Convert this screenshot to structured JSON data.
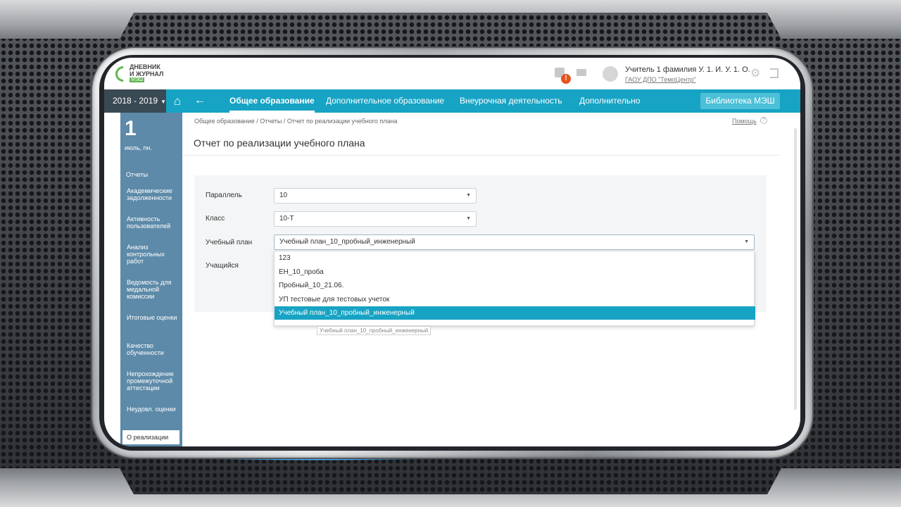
{
  "header": {
    "logo_line1": "ДНЕВНИК",
    "logo_line2": "И ЖУРНАЛ",
    "logo_badge": "МЭШ",
    "notification_badge": "!",
    "user_name": "Учитель 1 фамилия У. 1. И. У. 1. О.",
    "user_org": "ГАОУ ДПО \"ТемоЦентр\""
  },
  "nav": {
    "year": "2018 - 2019",
    "items": [
      {
        "label": "Общее образование",
        "active": true
      },
      {
        "label": "Дополнительное образование",
        "active": false
      },
      {
        "label": "Внеурочная деятельность",
        "active": false
      },
      {
        "label": "Дополнительно",
        "active": false
      }
    ],
    "library_button": "Библиотека МЭШ"
  },
  "sidebar": {
    "date_number": "1",
    "date_day": "июль, пн.",
    "section": "Отчеты",
    "items": [
      {
        "label": "Академические задолженности"
      },
      {
        "label": "Активность пользователей"
      },
      {
        "label": "Анализ контрольных работ"
      },
      {
        "label": "Ведомость для медальной комиссии"
      },
      {
        "label": "Итоговые оценки"
      },
      {
        "label": "Качество обученности"
      },
      {
        "label": "Непрохождение промежуточной аттестации"
      },
      {
        "label": "Неудовл. оценки"
      },
      {
        "label": "О реализации"
      }
    ]
  },
  "page": {
    "breadcrumb": "Общее образование / Отчеты / Отчет по реализации учебного плана",
    "help": "Помощь",
    "help_icon": "?",
    "title": "Отчет по реализации учебного плана"
  },
  "form": {
    "parallel_label": "Параллель",
    "parallel_value": "10",
    "class_label": "Класс",
    "class_value": "10-Т",
    "plan_label": "Учебный план",
    "plan_value": "Учебный план_10_пробный_инженерный",
    "student_label": "Учащийся"
  },
  "dropdown": {
    "options": [
      "123",
      "ЕН_10_проба",
      "Пробный_10_21.06.",
      "УП тестовые для тестовых учеток",
      "Учебный план_10_пробный_инженерный"
    ],
    "selected_index": 4,
    "tooltip": "Учебный план_10_пробный_инженерный"
  },
  "colors": {
    "accent": "#17a3c4",
    "sidebar": "#5d8aa8",
    "year_bg": "#3a4a55"
  }
}
